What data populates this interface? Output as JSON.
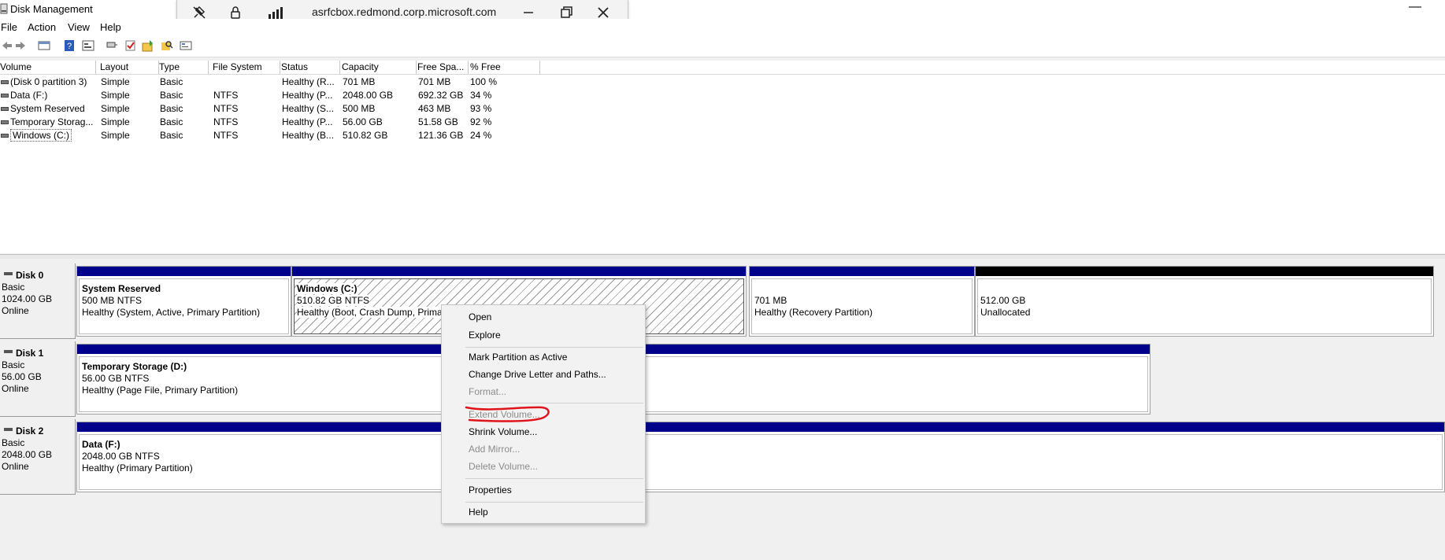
{
  "window": {
    "title": "Disk Management",
    "minimize_glyph": "—"
  },
  "remote_bar": {
    "host": "asrfcbox.redmond.corp.microsoft.com",
    "icons": [
      "unpin-icon",
      "lock-icon",
      "signal-icon",
      "minimize-icon",
      "restore-icon",
      "close-icon"
    ]
  },
  "menu": [
    "File",
    "Action",
    "View",
    "Help"
  ],
  "toolbar_icons": [
    "back-icon",
    "forward-icon",
    "disk-list-icon",
    "help-icon",
    "properties-icon",
    "connect-icon",
    "check-icon",
    "export-icon",
    "search-icon",
    "settings-icon"
  ],
  "volume_list": {
    "columns": [
      "Volume",
      "Layout",
      "Type",
      "File System",
      "Status",
      "Capacity",
      "Free Spa...",
      "% Free"
    ],
    "rows": [
      [
        "(Disk 0 partition 3)",
        "Simple",
        "Basic",
        "",
        "Healthy (R...",
        "701 MB",
        "701 MB",
        "100 %"
      ],
      [
        "Data (F:)",
        "Simple",
        "Basic",
        "NTFS",
        "Healthy (P...",
        "2048.00 GB",
        "692.32 GB",
        "34 %"
      ],
      [
        "System Reserved",
        "Simple",
        "Basic",
        "NTFS",
        "Healthy (S...",
        "500 MB",
        "463 MB",
        "93 %"
      ],
      [
        "Temporary Storag...",
        "Simple",
        "Basic",
        "NTFS",
        "Healthy (P...",
        "56.00 GB",
        "51.58 GB",
        "92 %"
      ],
      [
        "Windows (C:)",
        "Simple",
        "Basic",
        "NTFS",
        "Healthy (B...",
        "510.82 GB",
        "121.36 GB",
        "24 %"
      ]
    ]
  },
  "disks": [
    {
      "name": "Disk 0",
      "type": "Basic",
      "size": "1024.00 GB",
      "state": "Online",
      "partitions": [
        {
          "name": "System Reserved",
          "size": "500 MB NTFS",
          "status": "Healthy (System, Active, Primary Partition)"
        },
        {
          "name": "Windows  (C:)",
          "size": "510.82 GB NTFS",
          "status": "Healthy (Boot, Crash Dump, Prima"
        },
        {
          "name": "",
          "size": "701 MB",
          "status": "Healthy (Recovery Partition)"
        },
        {
          "name": "",
          "size": "512.00 GB",
          "status": "Unallocated"
        }
      ]
    },
    {
      "name": "Disk 1",
      "type": "Basic",
      "size": "56.00 GB",
      "state": "Online",
      "partitions": [
        {
          "name": "Temporary Storage  (D:)",
          "size": "56.00 GB NTFS",
          "status": "Healthy (Page File, Primary Partition)"
        }
      ]
    },
    {
      "name": "Disk 2",
      "type": "Basic",
      "size": "2048.00 GB",
      "state": "Online",
      "partitions": [
        {
          "name": "Data  (F:)",
          "size": "2048.00 GB NTFS",
          "status": "Healthy (Primary Partition)"
        }
      ]
    }
  ],
  "context_menu": {
    "open": "Open",
    "explore": "Explore",
    "mark_active": "Mark Partition as Active",
    "change_letter": "Change Drive Letter and Paths...",
    "format": "Format...",
    "extend": "Extend Volume...",
    "shrink": "Shrink Volume...",
    "add_mirror": "Add Mirror...",
    "delete": "Delete Volume...",
    "properties": "Properties",
    "help": "Help"
  },
  "colors": {
    "partition_bar": "#00008b",
    "unallocated_bar": "#000000",
    "annotation": "#e0131a",
    "disabled_text": "#8c8c8c"
  }
}
